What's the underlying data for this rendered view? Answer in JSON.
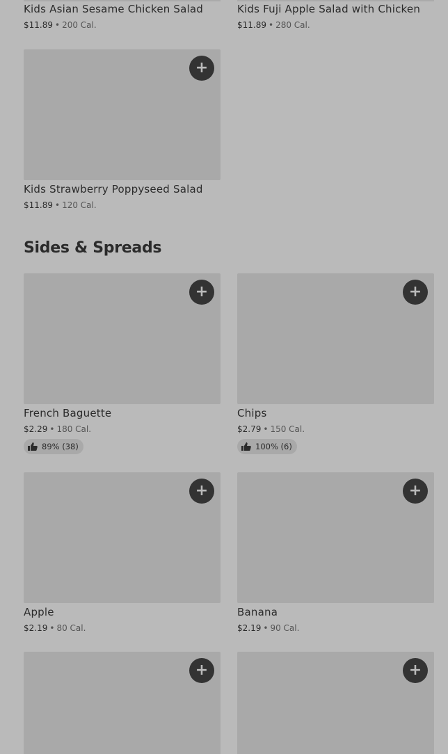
{
  "cards": {
    "kids_asian": {
      "name": "Kids Asian Sesame Chicken Salad",
      "price": "$11.89",
      "sep": "•",
      "cal": "200 Cal."
    },
    "kids_fuji": {
      "name": "Kids Fuji Apple Salad with Chicken",
      "price": "$11.89",
      "sep": "•",
      "cal": "280 Cal."
    },
    "kids_strawberry": {
      "name": "Kids Strawberry Poppyseed Salad",
      "price": "$11.89",
      "sep": "•",
      "cal": "120 Cal.",
      "add": "+"
    },
    "french_baguette": {
      "name": "French Baguette",
      "price": "$2.29",
      "sep": "•",
      "cal": "180 Cal.",
      "rating": "89% (38)",
      "add": "+"
    },
    "chips": {
      "name": "Chips",
      "price": "$2.79",
      "sep": "•",
      "cal": "150 Cal.",
      "rating": "100% (6)",
      "add": "+"
    },
    "apple": {
      "name": "Apple",
      "price": "$2.19",
      "sep": "•",
      "cal": "80 Cal.",
      "add": "+"
    },
    "banana": {
      "name": "Banana",
      "price": "$2.19",
      "sep": "•",
      "cal": "90 Cal.",
      "add": "+"
    },
    "next_left": {
      "add": "+"
    },
    "next_right": {
      "add": "+"
    }
  },
  "sections": {
    "sides_spreads": {
      "title": "Sides & Spreads"
    }
  },
  "icons": {
    "add": "plus-icon",
    "thumb": "thumbs-up-icon"
  },
  "colors": {
    "background": "#bababa",
    "image_placeholder": "#a9a9a9",
    "add_button": "#333333",
    "text": "#2b2b2b"
  }
}
